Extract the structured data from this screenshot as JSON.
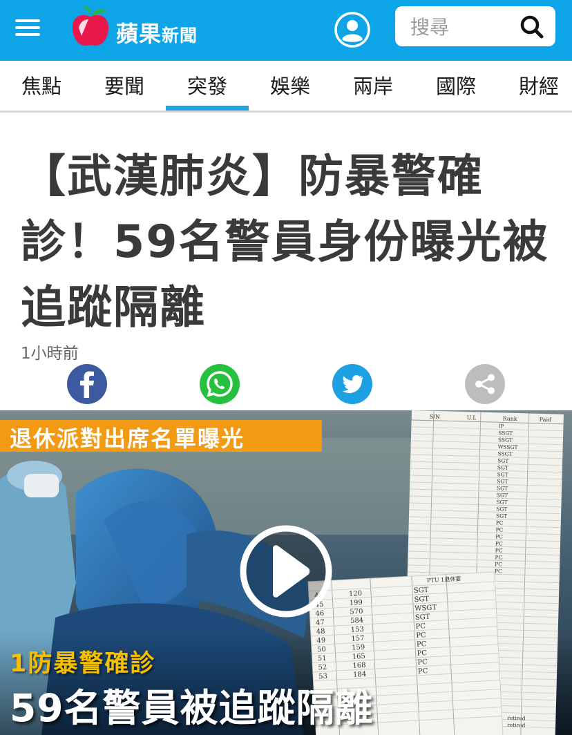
{
  "header": {
    "logo_main": "蘋果",
    "logo_sub": "新聞",
    "search_placeholder": "搜尋",
    "colors": {
      "bar": "#0ea5e8",
      "accent": "#1ea3e4"
    }
  },
  "nav": {
    "tabs": [
      {
        "label": "焦點"
      },
      {
        "label": "要聞"
      },
      {
        "label": "突發",
        "active": true
      },
      {
        "label": "娛樂"
      },
      {
        "label": "兩岸"
      },
      {
        "label": "國際"
      },
      {
        "label": "財經"
      }
    ]
  },
  "article": {
    "title": "【武漢肺炎】防暴警確診！59名警員身份曝光被追蹤隔離",
    "time": "1小時前"
  },
  "share": {
    "icons": [
      "facebook-icon",
      "whatsapp-icon",
      "twitter-icon",
      "share-icon"
    ],
    "colors": {
      "facebook": "#3b5a9f",
      "whatsapp": "#25c13e",
      "twitter": "#1da1e2",
      "share": "#bdbdbd"
    }
  },
  "video": {
    "banner": "退休派對出席名單曝光",
    "caption_line1": "1防暴警確診",
    "caption_line2": "59名警員被追蹤隔離",
    "sheet_headers": [
      "S/N",
      "U.I.",
      "Rank",
      "Paid"
    ],
    "sheet_ranks": [
      "IP",
      "SSGT",
      "SSGT",
      "WSSGT",
      "SSGT",
      "SGT",
      "SGT",
      "SGT",
      "SGT",
      "SGT",
      "SGT",
      "SGT",
      "SGT",
      "SGT",
      "PC",
      "PC",
      "PC",
      "PC",
      "PC",
      "PC",
      "PC",
      "PC"
    ],
    "sheet2_title": "PTU 1退休宴",
    "sheet2_rows": [
      {
        "sn": "44",
        "ui": "120",
        "rank": "SGT"
      },
      {
        "sn": "45",
        "ui": "199",
        "rank": "SGT"
      },
      {
        "sn": "46",
        "ui": "570",
        "rank": "WSGT"
      },
      {
        "sn": "47",
        "ui": "584",
        "rank": "SGT"
      },
      {
        "sn": "48",
        "ui": "153",
        "rank": "PC"
      },
      {
        "sn": "49",
        "ui": "157",
        "rank": "PC"
      },
      {
        "sn": "50",
        "ui": "159",
        "rank": "PC"
      },
      {
        "sn": "51",
        "ui": "165",
        "rank": "PC"
      },
      {
        "sn": "52",
        "ui": "168",
        "rank": "PC"
      },
      {
        "sn": "53",
        "ui": "184",
        "rank": "PC"
      }
    ],
    "sheet_notes": [
      "retired",
      "retired"
    ]
  }
}
